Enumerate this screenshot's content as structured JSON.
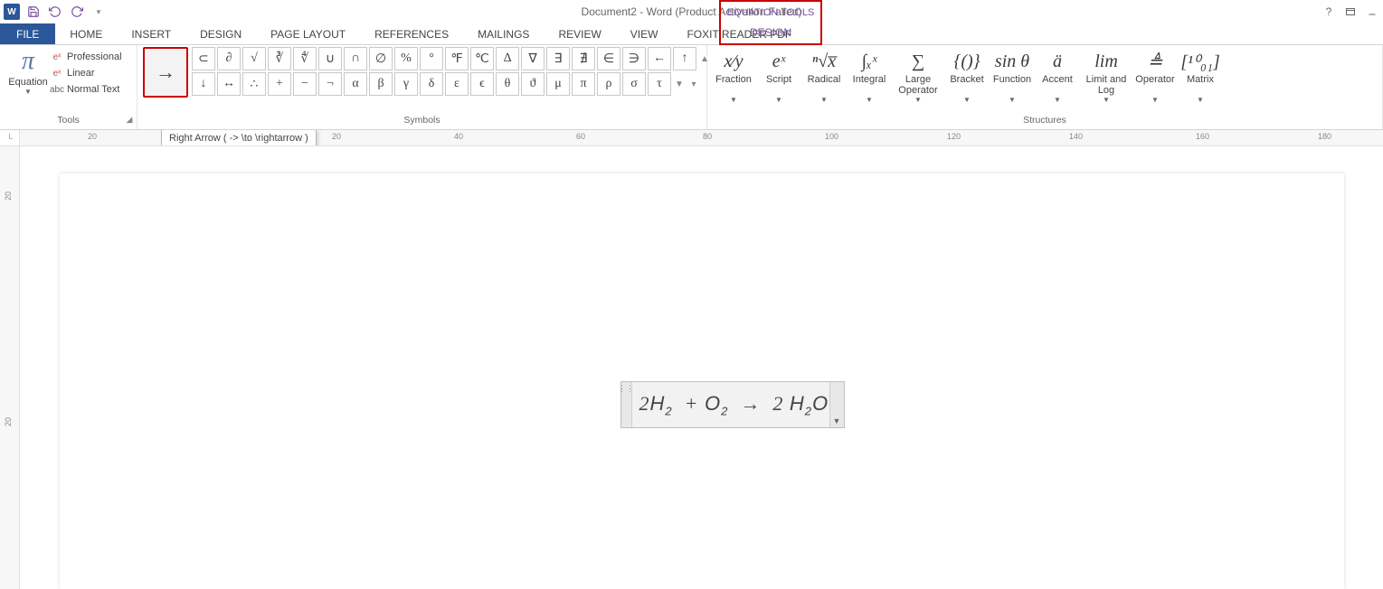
{
  "title": "Document2 - Word (Product Activation Failed)",
  "contextual_tab": "EQUATION TOOLS",
  "tabs": {
    "file": "FILE",
    "home": "HOME",
    "insert": "INSERT",
    "design": "DESIGN",
    "page_layout": "PAGE LAYOUT",
    "references": "REFERENCES",
    "mailings": "MAILINGS",
    "review": "REVIEW",
    "view": "VIEW",
    "foxit": "FOXIT READER PDF",
    "ctx_design": "DESIGN"
  },
  "groups": {
    "tools": {
      "label": "Tools",
      "equation": "Equation",
      "professional": "Professional",
      "linear": "Linear",
      "normal_text": "Normal Text"
    },
    "symbols": {
      "label": "Symbols",
      "row1": [
        "⊂",
        "∂",
        "√",
        "∛",
        "∜",
        "∪",
        "∩",
        "∅",
        "%",
        "°",
        "℉",
        "℃",
        "∆",
        "∇",
        "∃",
        "∄",
        "∈",
        "∋",
        "←",
        "↑"
      ],
      "row2": [
        "↓",
        "↔",
        "∴",
        "+",
        "−",
        "¬",
        "α",
        "β",
        "γ",
        "δ",
        "ε",
        "ϵ",
        "θ",
        "ϑ",
        "μ",
        "π",
        "ρ",
        "σ",
        "τ"
      ],
      "arrow_feature": "→"
    },
    "structures": {
      "label": "Structures",
      "items": [
        {
          "name": "fraction",
          "label": "Fraction",
          "icon": "x/y"
        },
        {
          "name": "script",
          "label": "Script",
          "icon": "eˣ"
        },
        {
          "name": "radical",
          "label": "Radical",
          "icon": "ⁿ√x"
        },
        {
          "name": "integral",
          "label": "Integral",
          "icon": "∫"
        },
        {
          "name": "large-operator",
          "label": "Large Operator ▾",
          "icon": "Σ"
        },
        {
          "name": "bracket",
          "label": "Bracket",
          "icon": "{()}"
        },
        {
          "name": "function",
          "label": "Function",
          "icon": "sin θ"
        },
        {
          "name": "accent",
          "label": "Accent",
          "icon": "ä"
        },
        {
          "name": "limit-log",
          "label": "Limit and Log ▾",
          "icon": "lim"
        },
        {
          "name": "operator",
          "label": "Operator",
          "icon": "≜"
        },
        {
          "name": "matrix",
          "label": "Matrix",
          "icon": "[10;01]"
        }
      ]
    }
  },
  "tooltip": "Right Arrow ( ->  \\to  \\rightarrow )",
  "ruler_h": [
    "20",
    "20",
    "40",
    "60",
    "80",
    "100",
    "120",
    "140",
    "160",
    "180"
  ],
  "ruler_v": [
    "20",
    "20"
  ],
  "equation_content": "2H₂  + O₂  →  2 H₂O"
}
